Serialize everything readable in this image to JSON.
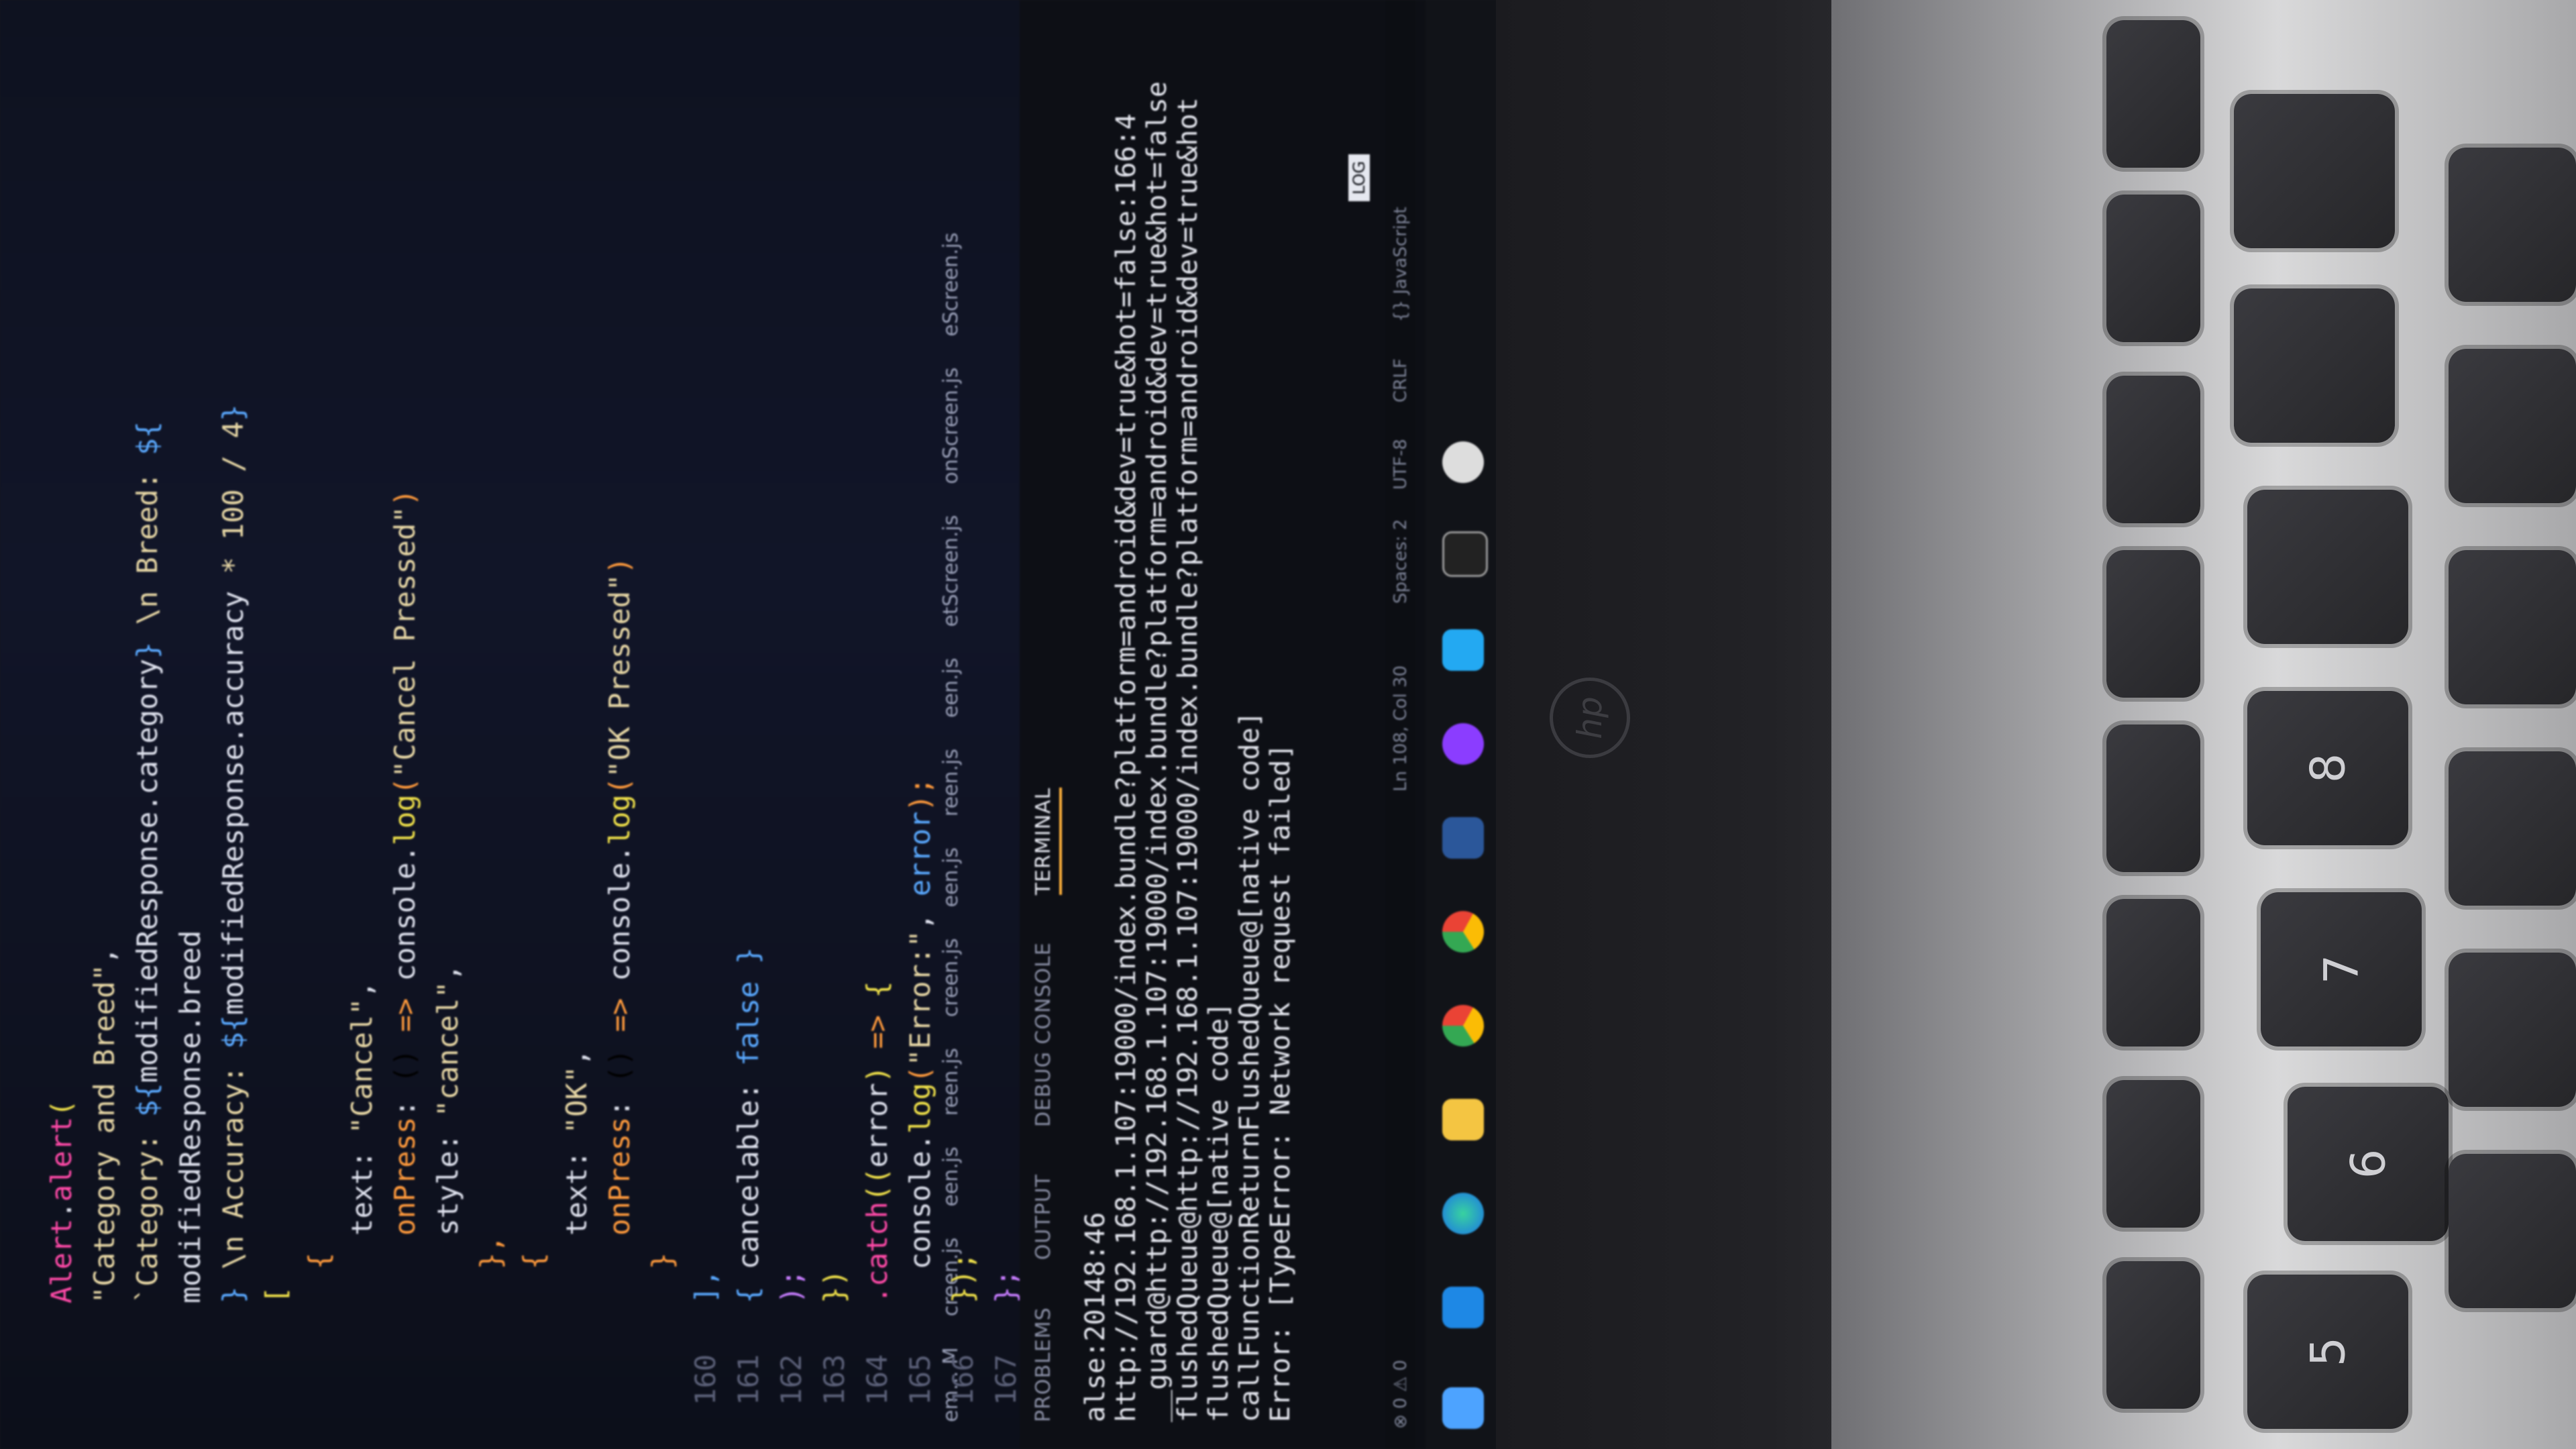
{
  "editor": {
    "lines": [
      {
        "num": "",
        "parts": [
          [
            "kw-pink",
            "Alert"
          ],
          [
            "white",
            "."
          ],
          [
            "kw-pink",
            "alert"
          ],
          [
            "kw-yellow",
            "("
          ]
        ]
      },
      {
        "num": "",
        "parts": [
          [
            "str",
            "\"Category and Breed\""
          ],
          [
            "white",
            ","
          ]
        ]
      },
      {
        "num": "",
        "parts": [
          [
            "str",
            "`Category: "
          ],
          [
            "kw-blue",
            "${"
          ],
          [
            "white",
            "modifiedResponse.category"
          ],
          [
            "kw-blue",
            "}"
          ],
          [
            "str",
            " \\n Breed: "
          ],
          [
            "kw-blue",
            "${"
          ]
        ]
      },
      {
        "num": "",
        "parts": [
          [
            "white",
            "modifiedResponse.breed"
          ]
        ]
      },
      {
        "num": "",
        "parts": [
          [
            "kw-blue",
            "}"
          ],
          [
            "str",
            " \\n Accuracy: "
          ],
          [
            "kw-blue",
            "${"
          ],
          [
            "white",
            "modifiedResponse.accuracy"
          ],
          [
            "str",
            " * 100 / 4"
          ],
          [
            "kw-blue",
            "}"
          ]
        ]
      },
      {
        "num": "",
        "parts": [
          [
            "kw-yellow",
            "["
          ]
        ]
      },
      {
        "num": "",
        "parts": [
          [
            "kw-orange",
            "  {"
          ]
        ]
      },
      {
        "num": "",
        "parts": [
          [
            "white",
            "    text: "
          ],
          [
            "str",
            "\"Cancel\""
          ],
          [
            "white",
            ","
          ]
        ]
      },
      {
        "num": "",
        "parts": [
          [
            "kw-orange",
            "    onPress"
          ],
          [
            "white",
            ": "
          ],
          [
            "kw-purple",
            "() "
          ],
          [
            "kw-orange",
            "=> "
          ],
          [
            "white",
            "console."
          ],
          [
            "kw-yellow",
            "log"
          ],
          [
            "kw-orange",
            "("
          ],
          [
            "str",
            "\"Cancel Pressed\""
          ],
          [
            "kw-orange",
            ")"
          ]
        ]
      },
      {
        "num": "",
        "parts": [
          [
            "white",
            "    style: "
          ],
          [
            "str",
            "\"cancel\""
          ],
          [
            "white",
            ","
          ]
        ]
      },
      {
        "num": "",
        "parts": [
          [
            "kw-orange",
            "  },"
          ]
        ]
      },
      {
        "num": "",
        "parts": [
          [
            "kw-orange",
            "  {"
          ]
        ]
      },
      {
        "num": "",
        "parts": [
          [
            "white",
            "    text: "
          ],
          [
            "str",
            "\"OK\""
          ],
          [
            "white",
            ","
          ]
        ]
      },
      {
        "num": "",
        "parts": [
          [
            "kw-orange",
            "    onPress"
          ],
          [
            "white",
            ": "
          ],
          [
            "kw-purple",
            "() "
          ],
          [
            "kw-orange",
            "=> "
          ],
          [
            "white",
            "console."
          ],
          [
            "kw-yellow",
            "log"
          ],
          [
            "kw-orange",
            "("
          ],
          [
            "str",
            "\"OK Pressed\""
          ],
          [
            "kw-orange",
            ")"
          ]
        ]
      },
      {
        "num": "",
        "parts": [
          [
            "kw-orange",
            "  }"
          ]
        ]
      },
      {
        "num": "160",
        "parts": [
          [
            "kw-blue",
            "],"
          ]
        ]
      },
      {
        "num": "161",
        "parts": [
          [
            "kw-blue",
            "{ "
          ],
          [
            "white",
            "cancelable: "
          ],
          [
            "kw-blue",
            "false "
          ],
          [
            "kw-blue",
            "}"
          ]
        ]
      },
      {
        "num": "162",
        "parts": [
          [
            "purple",
            ");"
          ]
        ]
      },
      {
        "num": "163",
        "parts": [
          [
            "kw-yellow",
            "})"
          ]
        ]
      },
      {
        "num": "164",
        "parts": [
          [
            "kw-pink",
            ".catch"
          ],
          [
            "kw-yellow",
            "(("
          ],
          [
            "white",
            "error"
          ],
          [
            "kw-yellow",
            ") "
          ],
          [
            "kw-orange",
            "=> "
          ],
          [
            "kw-yellow",
            "{"
          ]
        ]
      },
      {
        "num": "165",
        "parts": [
          [
            "white",
            "  console."
          ],
          [
            "kw-yellow",
            "log"
          ],
          [
            "kw-orange",
            "("
          ],
          [
            "str",
            "\"Error:\""
          ],
          [
            "white",
            ", "
          ],
          [
            "kw-blue",
            "error"
          ],
          [
            "kw-orange",
            ");"
          ]
        ]
      },
      {
        "num": "166",
        "parts": [
          [
            "kw-yellow",
            "});"
          ]
        ]
      },
      {
        "num": "167",
        "parts": [
          [
            "purple",
            "};"
          ]
        ]
      }
    ]
  },
  "explorer": {
    "items": [
      "em... M",
      "creen.js",
      "een.js",
      "reen.js",
      "creen.js",
      "een.js",
      "reen.js",
      "een.js",
      "etScreen.js",
      "onScreen.js",
      "eScreen.js"
    ]
  },
  "panel": {
    "tabs": [
      "PROBLEMS",
      "OUTPUT",
      "DEBUG CONSOLE",
      "TERMINAL"
    ],
    "active_tab": "TERMINAL",
    "terminal_lines": [
      "alse:20148:46",
      "http://192.168.1.107:19000/index.bundle?platform=android&dev=true&hot=false:166:4",
      "__guard@http://192.168.1.107:19000/index.bundle?platform=android&dev=true&hot=false",
      "flushedQueue@http://192.168.1.107:19000/index.bundle?platform=android&dev=true&hot",
      "flushedQueue@[native code]",
      "callFunctionReturnFlushedQueue@[native code]",
      "Error: [TypeError: Network request failed]"
    ],
    "log_badge": "LOG"
  },
  "statusbar": {
    "problems": "⊗ 0 ⚠ 0",
    "position": "Ln 108, Col 30",
    "spaces": "Spaces: 2",
    "encoding": "UTF-8",
    "eol": "CRLF",
    "language": "{} JavaScript"
  },
  "taskbar": {
    "icons": [
      "start-icon",
      "mail-icon",
      "edge-icon",
      "file-explorer-icon",
      "chrome-icon",
      "chrome-profile-icon",
      "word-icon",
      "canva-icon",
      "vscode-icon",
      "terminal-icon",
      "app-icon"
    ]
  },
  "laptop": {
    "logo": "hp",
    "keys": [
      {
        "label": "5",
        "sub": "%"
      },
      {
        "label": "6",
        "sub": "^"
      },
      {
        "label": "7",
        "sub": "&"
      },
      {
        "label": "8",
        "sub": "*"
      }
    ]
  },
  "colors": {
    "accent_tab": "#ffb13b",
    "editor_bg": "#0c0f1a",
    "keyboard": "#d9d9da"
  }
}
